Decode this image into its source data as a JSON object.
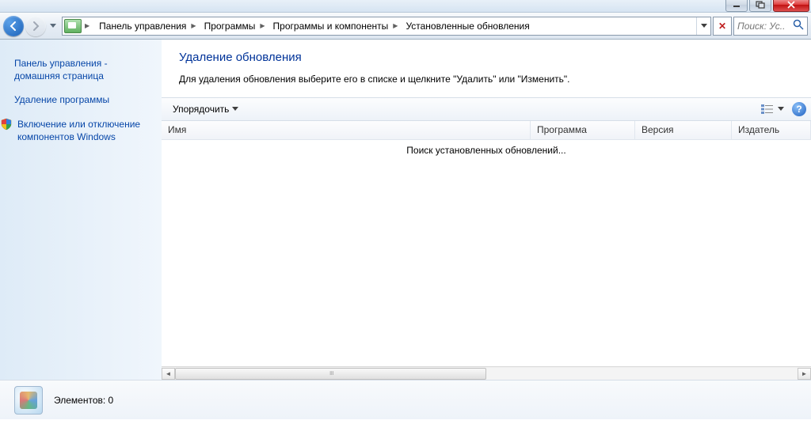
{
  "breadcrumbs": [
    "Панель управления",
    "Программы",
    "Программы и компоненты",
    "Установленные обновления"
  ],
  "search": {
    "placeholder": "Поиск: Ус..."
  },
  "sidebar": {
    "home": "Панель управления - домашняя страница",
    "uninstall": "Удаление программы",
    "features": "Включение или отключение компонентов Windows"
  },
  "main": {
    "title": "Удаление обновления",
    "desc": "Для удаления обновления выберите его в списке и щелкните \"Удалить\" или \"Изменить\"."
  },
  "toolbar": {
    "organize": "Упорядочить"
  },
  "columns": {
    "name": "Имя",
    "program": "Программа",
    "version": "Версия",
    "publisher": "Издатель"
  },
  "list": {
    "searching": "Поиск установленных обновлений..."
  },
  "status": {
    "items": "Элементов: 0"
  }
}
